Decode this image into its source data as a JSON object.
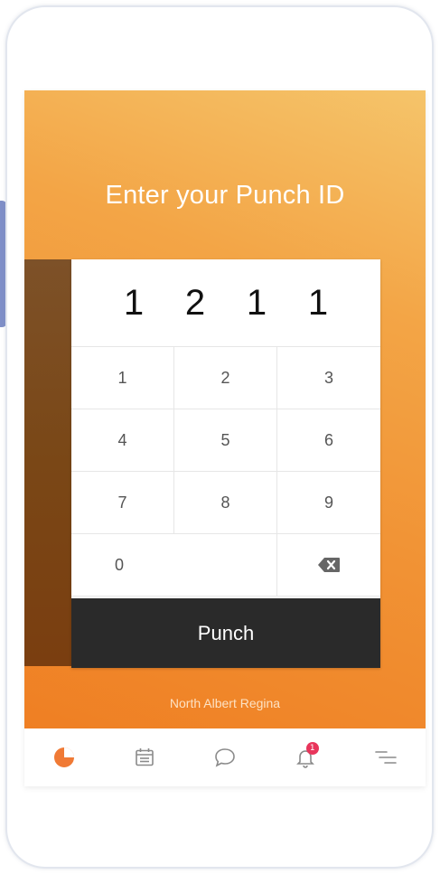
{
  "screen": {
    "title": "Enter your Punch ID",
    "pin_digits": [
      "1",
      "2",
      "1",
      "1"
    ],
    "keypad": {
      "keys": [
        "1",
        "2",
        "3",
        "4",
        "5",
        "6",
        "7",
        "8",
        "9"
      ],
      "zero": "0",
      "backspace_icon": "backspace-icon"
    },
    "punch_label": "Punch",
    "location": "North Albert Regina"
  },
  "bottom_nav": {
    "items": [
      {
        "icon": "clock-icon",
        "active": true
      },
      {
        "icon": "calendar-icon",
        "active": false
      },
      {
        "icon": "chat-icon",
        "active": false
      },
      {
        "icon": "bell-icon",
        "active": false,
        "badge": "1"
      },
      {
        "icon": "menu-icon",
        "active": false
      }
    ]
  },
  "colors": {
    "accent": "#f07a35",
    "badge": "#e8355b",
    "dark_button": "#2a2a2a"
  }
}
